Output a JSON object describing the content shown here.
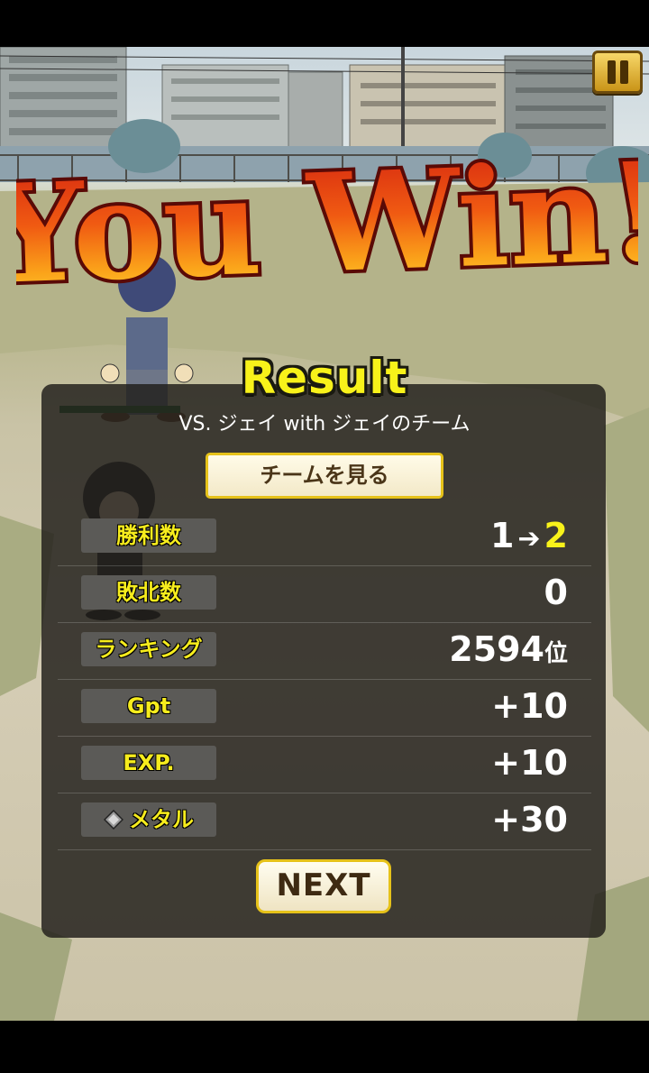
{
  "title": {
    "text": "You Win!"
  },
  "result": {
    "heading": "Result",
    "opponent_line": "VS. ジェイ with ジェイのチーム",
    "team_button_label": "チームを見る",
    "next_button_label": "NEXT",
    "rows": [
      {
        "label": "勝利数",
        "old": "1",
        "arrow": "➔",
        "new": "2"
      },
      {
        "label": "敗北数",
        "value": "0"
      },
      {
        "label": "ランキング",
        "value": "2594",
        "unit": "位"
      },
      {
        "label": "Gpt",
        "value": "+10"
      },
      {
        "label": "EXP.",
        "value": "+10"
      },
      {
        "label": "メタル",
        "value": "+30",
        "icon": "medal-icon"
      }
    ]
  },
  "colors": {
    "accent_yellow": "#f8f21a",
    "title_red": "#c81a0c",
    "panel_bg": "#201e1a",
    "button_border": "#e6c21a"
  }
}
